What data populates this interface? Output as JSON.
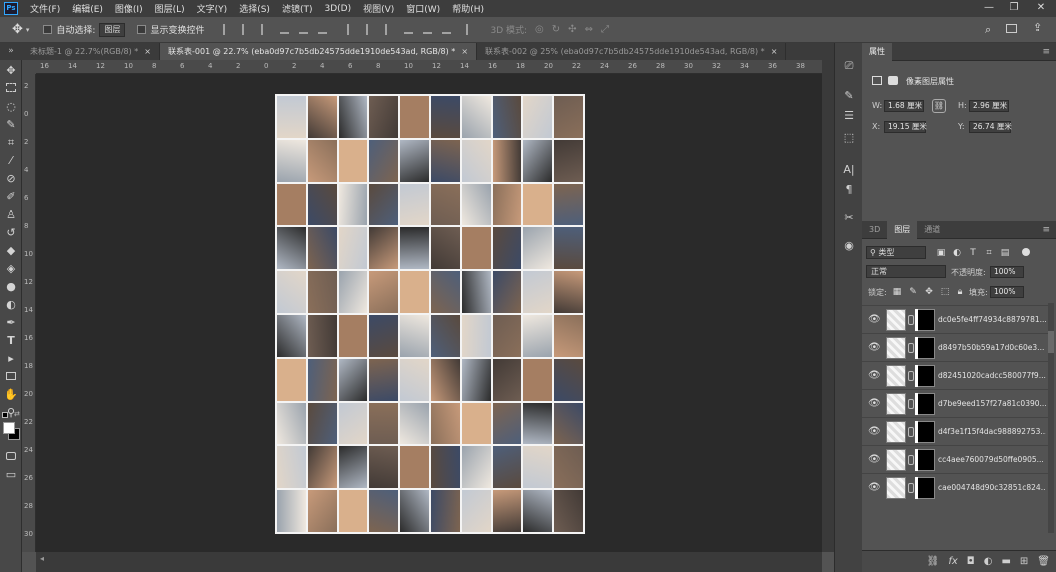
{
  "app": {
    "logo": "Ps"
  },
  "menu": [
    "文件(F)",
    "编辑(E)",
    "图像(I)",
    "图层(L)",
    "文字(Y)",
    "选择(S)",
    "滤镜(T)",
    "3D(D)",
    "视图(V)",
    "窗口(W)",
    "帮助(H)"
  ],
  "window_controls": {
    "minimize": "—",
    "restore": "❐",
    "close": "✕"
  },
  "options": {
    "auto_select_label": "自动选择:",
    "auto_select_target": "图层",
    "show_transform_label": "显示变换控件",
    "mode_3d_label": "3D 模式:"
  },
  "tabs": [
    {
      "label": "未标题-1 @ 22.7%(RGB/8) *",
      "active": false
    },
    {
      "label": "联系表-001 @ 22.7% (eba0d97c7b5db24575dde1910de543ad, RGB/8) *",
      "active": true
    },
    {
      "label": "联系表-002 @ 25% (eba0d97c7b5db24575dde1910de543ad, RGB/8) *",
      "active": false
    }
  ],
  "tab_close": "×",
  "ruler_h": [
    "16",
    "14",
    "12",
    "10",
    "8",
    "6",
    "4",
    "2",
    "0",
    "2",
    "4",
    "6",
    "8",
    "10",
    "12",
    "14",
    "16",
    "18",
    "20",
    "22",
    "24",
    "26",
    "28",
    "30",
    "32",
    "34",
    "36",
    "38"
  ],
  "ruler_v": [
    "2",
    "0",
    "2",
    "4",
    "6",
    "8",
    "10",
    "12",
    "14",
    "16",
    "18",
    "20",
    "22",
    "24",
    "26",
    "28",
    "30"
  ],
  "properties": {
    "title": "属性",
    "subtitle": "像素图层属性",
    "w_label": "W:",
    "w_value": "1.68 厘米",
    "h_label": "H:",
    "h_value": "2.96 厘米",
    "x_label": "X:",
    "x_value": "19.15 厘米",
    "y_label": "Y:",
    "y_value": "26.74 厘米"
  },
  "layers_panel": {
    "tabs": [
      {
        "label": "3D",
        "active": false
      },
      {
        "label": "图层",
        "active": true
      },
      {
        "label": "通道",
        "active": false
      }
    ],
    "filter_kind": "类型",
    "blend_mode": "正常",
    "opacity_label": "不透明度:",
    "opacity_value": "100%",
    "lock_label": "锁定:",
    "fill_label": "填充:",
    "fill_value": "100%",
    "layers": [
      {
        "name": "dc0e5fe4ff74934c8879781..."
      },
      {
        "name": "d8497b50b59a17d0c60e3..."
      },
      {
        "name": "d82451020cadcc580077f9..."
      },
      {
        "name": "d7be9eed157f27a81c0390..."
      },
      {
        "name": "d4f3e1f15f4dac988892753..."
      },
      {
        "name": "cc4aee760079d50ffe0905..."
      },
      {
        "name": "cae004748d90c32851c824..."
      }
    ]
  }
}
